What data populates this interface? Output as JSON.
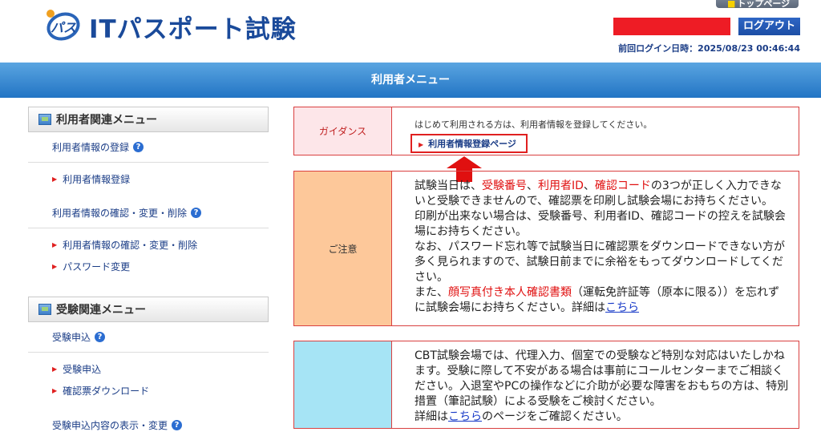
{
  "header": {
    "logo_mark": "パス",
    "title": "ITパスポート試験",
    "toppage_label": "トップページ",
    "logout_label": "ログアウト",
    "last_login_label": "前回ログイン日時：",
    "last_login_value": "2025/08/23 00:46:44"
  },
  "titlebar": {
    "label": "利用者メニュー"
  },
  "sidebar": {
    "sections": [
      {
        "heading": "利用者関連メニュー",
        "groups": [
          {
            "title": "利用者情報の登録",
            "links": [
              "利用者情報登録"
            ]
          },
          {
            "title": "利用者情報の確認・変更・削除",
            "links": [
              "利用者情報の確認・変更・削除",
              "パスワード変更"
            ]
          }
        ]
      },
      {
        "heading": "受験関連メニュー",
        "groups": [
          {
            "title": "受験申込",
            "links": [
              "受験申込",
              "確認票ダウンロード"
            ]
          },
          {
            "title": "受験申込内容の表示・変更",
            "links": []
          }
        ]
      }
    ],
    "help_icon": "?"
  },
  "guidance": {
    "label": "ガイダンス",
    "text": "はじめて利用される方は、利用者情報を登録してください。",
    "link_label": "利用者情報登録ページ"
  },
  "caution": {
    "label": "ご注意",
    "p1_a": "試験当日は、",
    "p1_red1": "受験番号",
    "p1_sep1": "、",
    "p1_red2": "利用者ID",
    "p1_sep2": "、",
    "p1_red3": "確認コード",
    "p1_b": "の3つが正しく入力できないと受験できませんので、確認票を印刷し試験会場にお持ちください。",
    "p2": "印刷が出来ない場合は、受験番号、利用者ID、確認コードの控えを試験会場にお持ちください。",
    "p3": "なお、パスワード忘れ等で試験当日に確認票をダウンロードできない方が多く見られますので、試験日前までに余裕をもってダウンロードしてください。",
    "p4_a": "また、",
    "p4_red": "顔写真付き本人確認書類",
    "p4_b": "（運転免許証等（原本に限る））を忘れずに試験会場にお持ちください。詳細は",
    "p4_link": "こちら"
  },
  "cbt": {
    "label": "",
    "p1": "CBT試験会場では、代理入力、個室での受験など特別な対応はいたしかねます。受験に際して不安がある場合は事前にコールセンターまでご相談ください。入退室やPCの操作などに介助が必要な障害をおもちの方は、特別措置（筆記試験）による受験をご検討ください。",
    "p2_a": "詳細は",
    "p2_link": "こちら",
    "p2_b": "のページをご確認ください。"
  },
  "colors": {
    "brand_blue": "#1a4a9a",
    "accent_red": "#e01010",
    "titlebar_blue": "#2274c4"
  }
}
